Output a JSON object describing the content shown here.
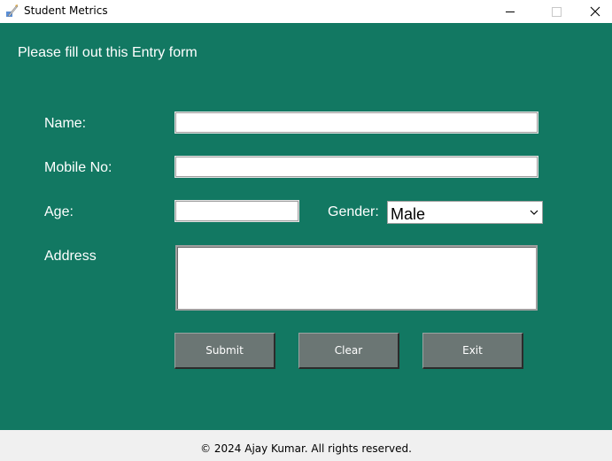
{
  "window": {
    "title": "Student Metrics",
    "icon": "feather-quill-icon",
    "controls": [
      "minimize-icon",
      "maximize-icon",
      "close-icon"
    ]
  },
  "form": {
    "heading": "Please fill out this Entry form",
    "name_label": "Name:",
    "name_value": "",
    "mobile_label": "Mobile No:",
    "mobile_value": "",
    "age_label": "Age:",
    "age_value": "",
    "gender_label": "Gender:",
    "gender_value": "Male",
    "address_label": "Address",
    "address_value": ""
  },
  "buttons": {
    "submit": "Submit",
    "clear": "Clear",
    "exit": "Exit"
  },
  "footer": {
    "text": "© 2024 Ajay Kumar. All rights reserved."
  },
  "colors": {
    "background": "#127862",
    "button": "#6b7674",
    "footer_bg": "#f0f0f0"
  }
}
